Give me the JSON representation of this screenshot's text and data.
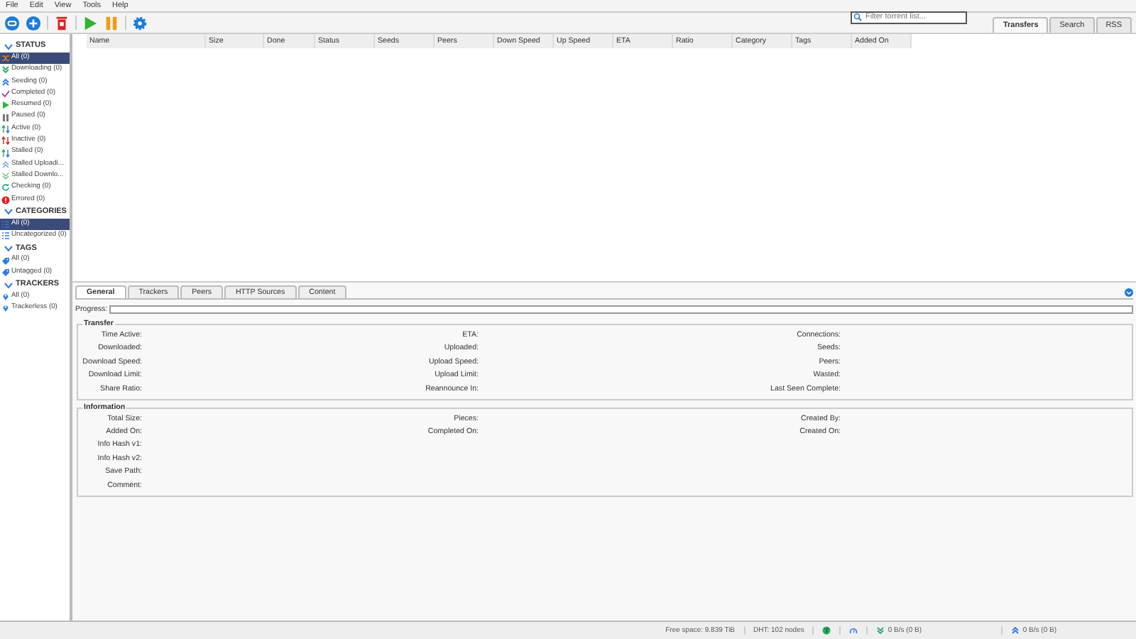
{
  "menu": [
    "File",
    "Edit",
    "View",
    "Tools",
    "Help"
  ],
  "search": {
    "placeholder": "Filter torrent list..."
  },
  "main_tabs": [
    {
      "label": "Transfers",
      "selected": true
    },
    {
      "label": "Search",
      "selected": false
    },
    {
      "label": "RSS",
      "selected": false
    }
  ],
  "sidebar": {
    "sections": [
      {
        "title": "STATUS",
        "items": [
          {
            "label": "All (0)",
            "kind": "all",
            "selected": true
          },
          {
            "label": "Downloading (0)",
            "kind": "downloading",
            "selected": false
          },
          {
            "label": "Seeding (0)",
            "kind": "seeding",
            "selected": false
          },
          {
            "label": "Completed (0)",
            "kind": "completed",
            "selected": false
          },
          {
            "label": "Resumed (0)",
            "kind": "resumed",
            "selected": false
          },
          {
            "label": "Paused (0)",
            "kind": "paused",
            "selected": false
          },
          {
            "label": "Active (0)",
            "kind": "active",
            "selected": false
          },
          {
            "label": "Inactive (0)",
            "kind": "inactive",
            "selected": false
          },
          {
            "label": "Stalled (0)",
            "kind": "stalled",
            "selected": false
          },
          {
            "label": "Stalled Uploadi...",
            "kind": "stalledup",
            "selected": false
          },
          {
            "label": "Stalled Downlo...",
            "kind": "stalleddown",
            "selected": false
          },
          {
            "label": "Checking (0)",
            "kind": "checking",
            "selected": false
          },
          {
            "label": "Errored (0)",
            "kind": "errored",
            "selected": false
          }
        ]
      },
      {
        "title": "CATEGORIES",
        "items": [
          {
            "label": "All (0)",
            "kind": "category",
            "selected": true
          },
          {
            "label": "Uncategorized (0)",
            "kind": "category",
            "selected": false
          }
        ]
      },
      {
        "title": "TAGS",
        "items": [
          {
            "label": "All (0)",
            "kind": "tag",
            "selected": false
          },
          {
            "label": "Untagged (0)",
            "kind": "tag",
            "selected": false
          }
        ]
      },
      {
        "title": "TRACKERS",
        "items": [
          {
            "label": "All (0)",
            "kind": "tracker",
            "selected": false
          },
          {
            "label": "Trackerless (0)",
            "kind": "tracker",
            "selected": false
          }
        ]
      }
    ]
  },
  "table": {
    "columns": [
      "Name",
      "Size",
      "Done",
      "Status",
      "Seeds",
      "Peers",
      "Down Speed",
      "Up Speed",
      "ETA",
      "Ratio",
      "Category",
      "Tags",
      "Added On"
    ]
  },
  "details": {
    "tabs": [
      {
        "label": "General",
        "selected": true
      },
      {
        "label": "Trackers",
        "selected": false
      },
      {
        "label": "Peers",
        "selected": false
      },
      {
        "label": "HTTP Sources",
        "selected": false
      },
      {
        "label": "Content",
        "selected": false
      }
    ],
    "progress": {
      "label": "Progress:",
      "level": 0
    },
    "sections": [
      {
        "title": "Transfer",
        "rows": [
          [
            "Time Active:",
            "ETA:",
            "Connections:"
          ],
          [
            "Downloaded:",
            "Uploaded:",
            "Seeds:"
          ],
          [
            "Download Speed:",
            "Upload Speed:",
            "Peers:"
          ],
          [
            "Download Limit:",
            "Upload Limit:",
            "Wasted:"
          ],
          [
            "Share Ratio:",
            "Reannounce In:",
            "Last Seen Complete:"
          ]
        ]
      },
      {
        "title": "Information",
        "rows": [
          [
            "Total Size:",
            "Pieces:",
            "Created By:"
          ],
          [
            "Added On:",
            "Completed On:",
            "Created On:"
          ],
          [
            "Info Hash v1:"
          ],
          [
            "Info Hash v2:"
          ],
          [
            "Save Path:"
          ],
          [
            "Comment:"
          ]
        ]
      }
    ]
  },
  "status_bar": {
    "free_space": "Free space: 9.839 TiB",
    "dht": "DHT: 102 nodes",
    "download": "0 B/s (0 B)",
    "upload": "0 B/s (0 B)"
  }
}
